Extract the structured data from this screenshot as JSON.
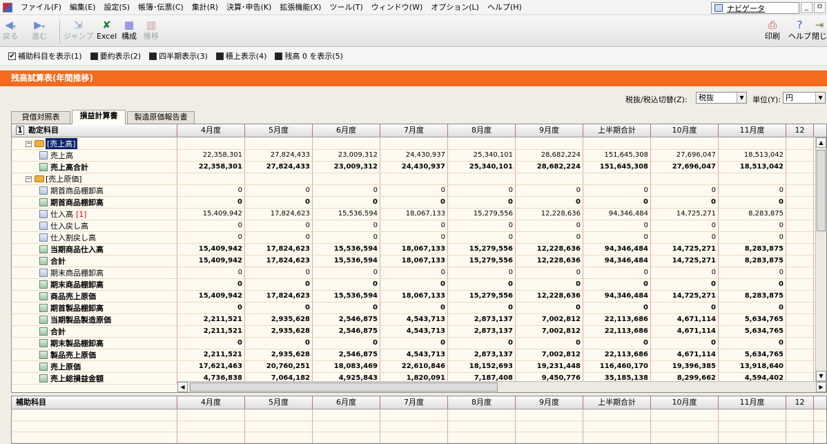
{
  "menubar": {
    "items": [
      "ファイル(F)",
      "編集(E)",
      "設定(S)",
      "帳簿･伝票(C)",
      "集計(R)",
      "決算･申告(K)",
      "拡張機能(X)",
      "ツール(T)",
      "ウィンドウ(W)",
      "オプション(L)",
      "ヘルプ(H)"
    ],
    "navigator": "ナビゲータ",
    "window_buttons": [
      "_",
      "ㅁ"
    ]
  },
  "toolbar": {
    "back": "戻る",
    "forward": "進む",
    "jump": "ジャンプ",
    "excel": "Excel",
    "compose": "構成",
    "transition": "推移",
    "print": "印刷",
    "help": "ヘルプ",
    "close": "閉じ"
  },
  "options": [
    "補助科目を表示(1)",
    "要約表示(2)",
    "四半期表示(3)",
    "積上表示(4)",
    "残高 0 を表示(5)"
  ],
  "title": "残高試算表(年間推移)",
  "controls": {
    "tax_label": "税抜/税込切替(Z):",
    "tax_value": "税抜",
    "unit_label": "単位(Y):",
    "unit_value": "円"
  },
  "tabs": [
    "貸借対照表",
    "損益計算書",
    "製造原価報告書"
  ],
  "grid": {
    "header_num": "1",
    "account_header": "勘定科目",
    "columns": [
      "4月度",
      "5月度",
      "6月度",
      "7月度",
      "8月度",
      "9月度",
      "上半期合計",
      "10月度",
      "11月度",
      "12"
    ],
    "rows": [
      {
        "label": "[売上高]",
        "level": 0,
        "selected": true,
        "values": [
          "",
          "",
          "",
          "",
          "",
          "",
          "",
          "",
          ""
        ]
      },
      {
        "label": "売上高",
        "level": 1,
        "values": [
          "22,358,301",
          "27,824,433",
          "23,009,312",
          "24,430,937",
          "25,340,101",
          "28,682,224",
          "151,645,308",
          "27,696,047",
          "18,513,042"
        ]
      },
      {
        "label": "売上高合計",
        "level": 1,
        "sum": true,
        "bold": true,
        "values": [
          "22,358,301",
          "27,824,433",
          "23,009,312",
          "24,430,937",
          "25,340,101",
          "28,682,224",
          "151,645,308",
          "27,696,047",
          "18,513,042"
        ]
      },
      {
        "label": "[売上原価]",
        "level": 0,
        "values": [
          "",
          "",
          "",
          "",
          "",
          "",
          "",
          "",
          ""
        ]
      },
      {
        "label": "期首商品棚卸高",
        "level": 1,
        "values": [
          "0",
          "0",
          "0",
          "0",
          "0",
          "0",
          "0",
          "0",
          "0"
        ]
      },
      {
        "label": "期首商品棚卸高",
        "level": 1,
        "sum": true,
        "bold": true,
        "values": [
          "0",
          "0",
          "0",
          "0",
          "0",
          "0",
          "0",
          "0",
          "0"
        ]
      },
      {
        "label": "仕入高",
        "level": 1,
        "mark": "[1]",
        "values": [
          "15,409,942",
          "17,824,623",
          "15,536,594",
          "18,067,133",
          "15,279,556",
          "12,228,636",
          "94,346,484",
          "14,725,271",
          "8,283,875"
        ]
      },
      {
        "label": "仕入戻し高",
        "level": 1,
        "values": [
          "0",
          "0",
          "0",
          "0",
          "0",
          "0",
          "0",
          "0",
          "0"
        ]
      },
      {
        "label": "仕入割戻し高",
        "level": 1,
        "values": [
          "0",
          "0",
          "0",
          "0",
          "0",
          "0",
          "0",
          "0",
          "0"
        ]
      },
      {
        "label": "当期商品仕入高",
        "level": 1,
        "sum": true,
        "bold": true,
        "values": [
          "15,409,942",
          "17,824,623",
          "15,536,594",
          "18,067,133",
          "15,279,556",
          "12,228,636",
          "94,346,484",
          "14,725,271",
          "8,283,875"
        ]
      },
      {
        "label": "合計",
        "level": 1,
        "sum": true,
        "bold": true,
        "values": [
          "15,409,942",
          "17,824,623",
          "15,536,594",
          "18,067,133",
          "15,279,556",
          "12,228,636",
          "94,346,484",
          "14,725,271",
          "8,283,875"
        ]
      },
      {
        "label": "期末商品棚卸高",
        "level": 1,
        "values": [
          "0",
          "0",
          "0",
          "0",
          "0",
          "0",
          "0",
          "0",
          "0"
        ]
      },
      {
        "label": "期末商品棚卸高",
        "level": 1,
        "sum": true,
        "bold": true,
        "values": [
          "0",
          "0",
          "0",
          "0",
          "0",
          "0",
          "0",
          "0",
          "0"
        ]
      },
      {
        "label": "商品売上原価",
        "level": 1,
        "sum": true,
        "bold": true,
        "values": [
          "15,409,942",
          "17,824,623",
          "15,536,594",
          "18,067,133",
          "15,279,556",
          "12,228,636",
          "94,346,484",
          "14,725,271",
          "8,283,875"
        ]
      },
      {
        "label": "期首製品棚卸高",
        "level": 1,
        "sum": true,
        "bold": true,
        "values": [
          "0",
          "0",
          "0",
          "0",
          "0",
          "0",
          "0",
          "0",
          "0"
        ]
      },
      {
        "label": "当期製品製造原価",
        "level": 1,
        "sum": true,
        "bold": true,
        "values": [
          "2,211,521",
          "2,935,628",
          "2,546,875",
          "4,543,713",
          "2,873,137",
          "7,002,812",
          "22,113,686",
          "4,671,114",
          "5,634,765"
        ]
      },
      {
        "label": "合計",
        "level": 1,
        "sum": true,
        "bold": true,
        "values": [
          "2,211,521",
          "2,935,628",
          "2,546,875",
          "4,543,713",
          "2,873,137",
          "7,002,812",
          "22,113,686",
          "4,671,114",
          "5,634,765"
        ]
      },
      {
        "label": "期末製品棚卸高",
        "level": 1,
        "sum": true,
        "bold": true,
        "values": [
          "0",
          "0",
          "0",
          "0",
          "0",
          "0",
          "0",
          "0",
          "0"
        ]
      },
      {
        "label": "製品売上原価",
        "level": 1,
        "sum": true,
        "bold": true,
        "values": [
          "2,211,521",
          "2,935,628",
          "2,546,875",
          "4,543,713",
          "2,873,137",
          "7,002,812",
          "22,113,686",
          "4,671,114",
          "5,634,765"
        ]
      },
      {
        "label": "売上原価",
        "level": 1,
        "sum": true,
        "bold": true,
        "values": [
          "17,621,463",
          "20,760,251",
          "18,083,469",
          "22,610,846",
          "18,152,693",
          "19,231,448",
          "116,460,170",
          "19,396,385",
          "13,918,640"
        ]
      },
      {
        "label": "売上総損益金額",
        "level": 1,
        "sum": true,
        "bold": true,
        "values": [
          "4,736,838",
          "7,064,182",
          "4,925,843",
          "1,820,091",
          "7,187,408",
          "9,450,776",
          "35,185,138",
          "8,299,662",
          "4,594,402"
        ]
      }
    ]
  },
  "sub_grid": {
    "account_header": "補助科目",
    "columns": [
      "4月度",
      "5月度",
      "6月度",
      "7月度",
      "8月度",
      "9月度",
      "上半期合計",
      "10月度",
      "11月度",
      "12"
    ]
  }
}
